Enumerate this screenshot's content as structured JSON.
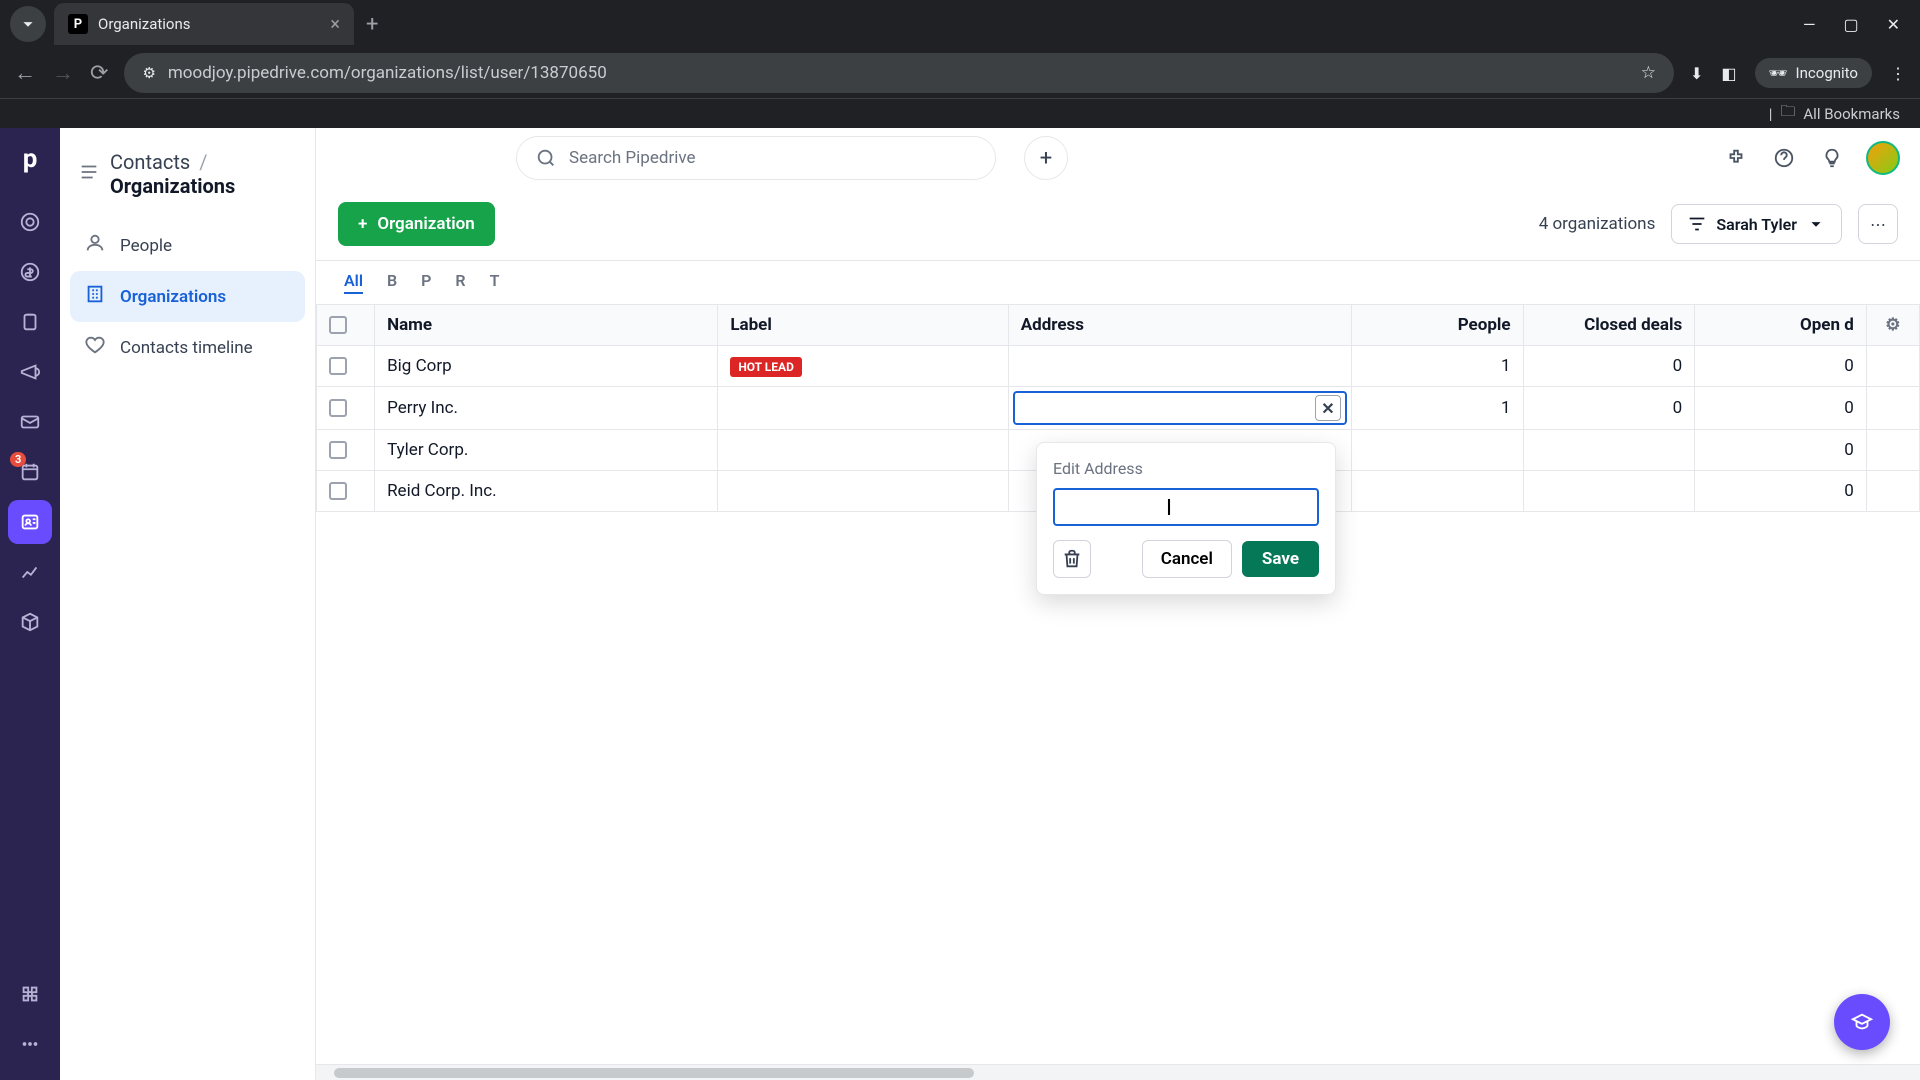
{
  "browser": {
    "tab_title": "Organizations",
    "url": "moodjoy.pipedrive.com/organizations/list/user/13870650",
    "incognito_label": "Incognito",
    "bookmarks_label": "All Bookmarks"
  },
  "breadcrumb": {
    "parent": "Contacts",
    "current": "Organizations"
  },
  "search": {
    "placeholder": "Search Pipedrive"
  },
  "sidebar": {
    "items": [
      {
        "label": "People"
      },
      {
        "label": "Organizations"
      },
      {
        "label": "Contacts timeline"
      }
    ]
  },
  "rail_badge": "3",
  "header": {
    "new_button": "Organization",
    "count_text": "4 organizations",
    "filter_user": "Sarah Tyler"
  },
  "alpha": {
    "all": "All",
    "letters": [
      "B",
      "P",
      "R",
      "T"
    ]
  },
  "table": {
    "columns": {
      "name": "Name",
      "label": "Label",
      "address": "Address",
      "people": "People",
      "closed": "Closed deals",
      "open": "Open d"
    },
    "rows": [
      {
        "name": "Big Corp",
        "label": "HOT LEAD",
        "address": "",
        "people": "1",
        "closed": "0",
        "open": "0"
      },
      {
        "name": "Perry Inc.",
        "label": "",
        "address": "",
        "people": "1",
        "closed": "0",
        "open": "0"
      },
      {
        "name": "Tyler Corp.",
        "label": "",
        "address": "",
        "people": "",
        "closed": "",
        "open": "0"
      },
      {
        "name": "Reid Corp. Inc.",
        "label": "",
        "address": "",
        "people": "",
        "closed": "",
        "open": "0"
      }
    ]
  },
  "popover": {
    "title": "Edit Address",
    "value": "",
    "cancel": "Cancel",
    "save": "Save"
  }
}
